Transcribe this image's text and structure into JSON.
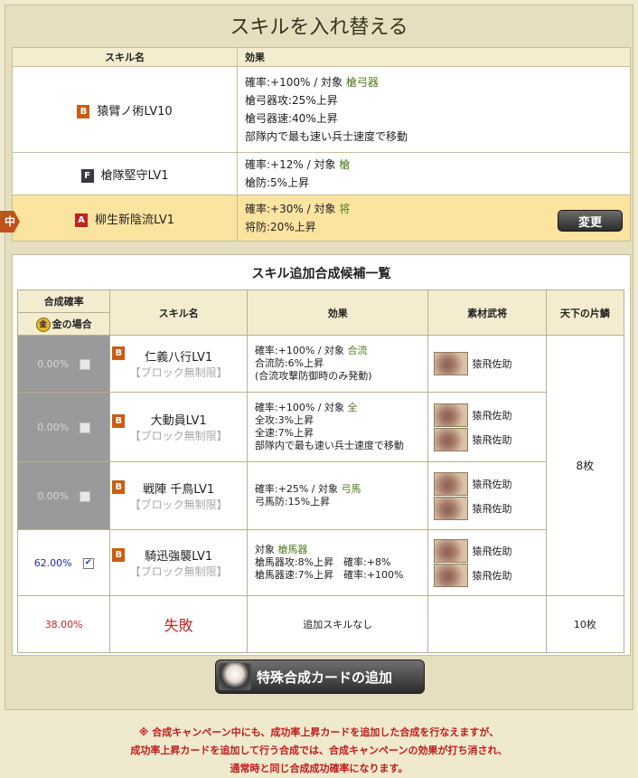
{
  "header": {
    "title": "スキルを入れ替える"
  },
  "current_skills": {
    "headers": [
      "スキル名",
      "効果"
    ],
    "rows": [
      {
        "rank": "B",
        "name": "猿臂ノ術LV10",
        "effects": [
          [
            "確率:+100% / 対象 ",
            "槍弓器"
          ],
          [
            "槍弓器攻:25%上昇",
            ""
          ],
          [
            "槍弓器速:40%上昇",
            ""
          ],
          [
            "部隊内で最も速い兵士速度で移動",
            ""
          ]
        ]
      },
      {
        "rank": "F",
        "name": "槍隊堅守LV1",
        "effects": [
          [
            "確率:+12% / 対象 ",
            "槍"
          ],
          [
            "槍防:5%上昇",
            ""
          ]
        ]
      },
      {
        "rank": "A",
        "name": "柳生新陰流LV1",
        "effects": [
          [
            "確率:+30% / 対象 ",
            "将"
          ],
          [
            "将防:20%上昇",
            ""
          ]
        ]
      }
    ],
    "active_marker": "中",
    "change_label": "変更"
  },
  "candidates": {
    "title": "スキル追加合成候補一覧",
    "headers": {
      "rate": "合成確率",
      "gold": "金の場合",
      "gold_icon": "金",
      "name": "スキル名",
      "effect": "効果",
      "material": "素材武将",
      "kata": "天下の片鱗"
    },
    "rows": [
      {
        "rate": "0.00%",
        "checked": false,
        "rank": "B",
        "name": "仁義八行LV1",
        "block": "【ブロック無制限】",
        "effects": [
          [
            "確率:+100% / 対象 ",
            "合流"
          ],
          [
            "合流防:6%上昇",
            ""
          ],
          [
            "(合流攻撃防御時のみ発動)",
            ""
          ]
        ],
        "materials": [
          "猿飛佐助"
        ]
      },
      {
        "rate": "0.00%",
        "checked": false,
        "rank": "B",
        "name": "大動員LV1",
        "block": "【ブロック無制限】",
        "effects": [
          [
            "確率:+100% / 対象 ",
            "全"
          ],
          [
            "全攻:3%上昇",
            ""
          ],
          [
            "全速:7%上昇",
            ""
          ],
          [
            "部隊内で最も速い兵士速度で移動",
            ""
          ]
        ],
        "materials": [
          "猿飛佐助",
          "猿飛佐助"
        ]
      },
      {
        "rate": "0.00%",
        "checked": false,
        "rank": "B",
        "name": "戦陣 千鳥LV1",
        "block": "【ブロック無制限】",
        "effects": [
          [
            "確率:+25% / 対象 ",
            "弓馬"
          ],
          [
            "弓馬防:15%上昇",
            ""
          ]
        ],
        "materials": [
          "猿飛佐助",
          "猿飛佐助"
        ]
      },
      {
        "rate": "62.00%",
        "checked": true,
        "rank": "B",
        "name": "騎迅強襲LV1",
        "block": "【ブロック無制限】",
        "effects": [
          [
            "対象 ",
            "槍馬器"
          ],
          [
            "槍馬器攻:8%上昇　確率:+8%",
            ""
          ],
          [
            "槍馬器速:7%上昇　確率:+100%",
            ""
          ]
        ],
        "materials": [
          "猿飛佐助",
          "猿飛佐助"
        ]
      }
    ],
    "kata_count": "8枚",
    "fail": {
      "rate": "38.00%",
      "label": "失敗",
      "effect": "追加スキルなし",
      "kata": "10枚"
    }
  },
  "special_card_label": "特殊合成カードの追加",
  "notice": [
    "※ 合成キャンペーン中にも、成功率上昇カードを追加した合成を行なえますが、",
    "成功率上昇カードを追加して行う合成では、合成キャンペーンの効果が打ち消され、",
    "通常時と同じ合成成功確率になります。"
  ],
  "colors": {
    "target": "#4f7a1e",
    "active_row": "#fbe3a0",
    "notice": "#c21c1c",
    "success_rate": "#1d2ab8",
    "fail_rate": "#c52525"
  }
}
